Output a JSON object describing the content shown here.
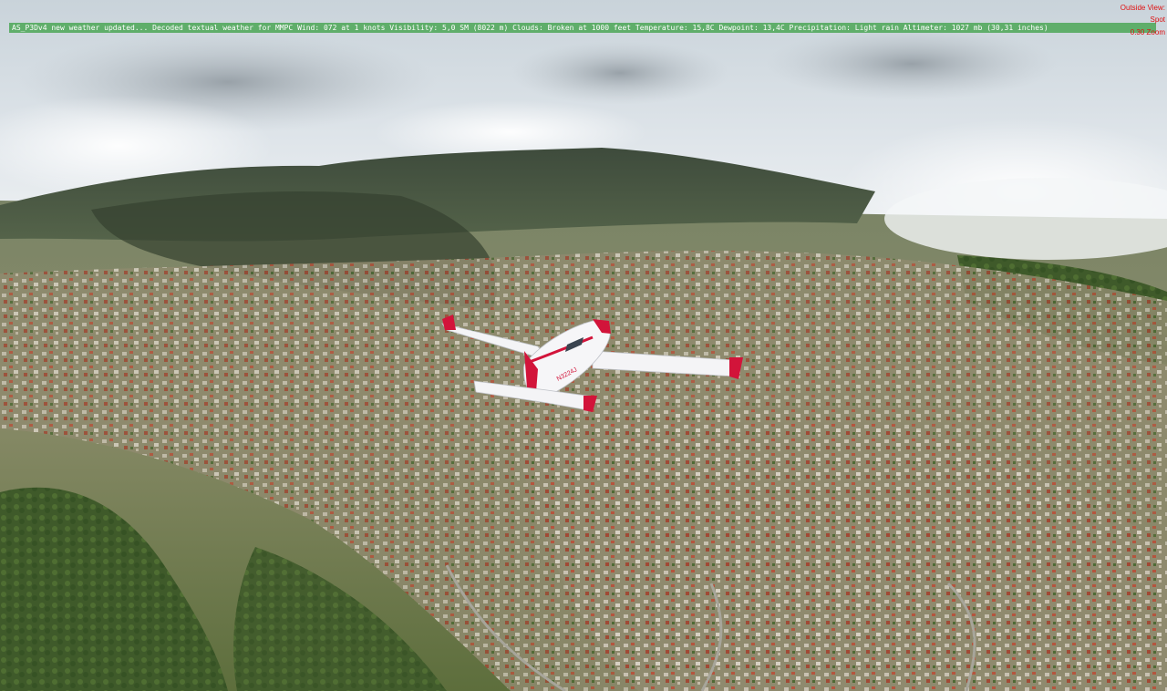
{
  "weather_message": "AS_P3Dv4 new weather updated... Decoded textual weather for MMPC  Wind: 072 at 1 knots  Visibility: 5,0 SM (8022 m) Clouds: Broken at 1000 feet Temperature: 15,8C Dewpoint: 13,4C Precipitation: Light rain  Altimeter: 1027 mb (30,31 inches)",
  "view": {
    "mode": "Outside View:",
    "type": "Spot",
    "zoom": "0.30 Zoom"
  },
  "aircraft": {
    "registration": "N3224J"
  },
  "colors": {
    "message_bar": "#5fae6a",
    "view_text": "#e01010",
    "aircraft_trim": "#d2143a"
  }
}
